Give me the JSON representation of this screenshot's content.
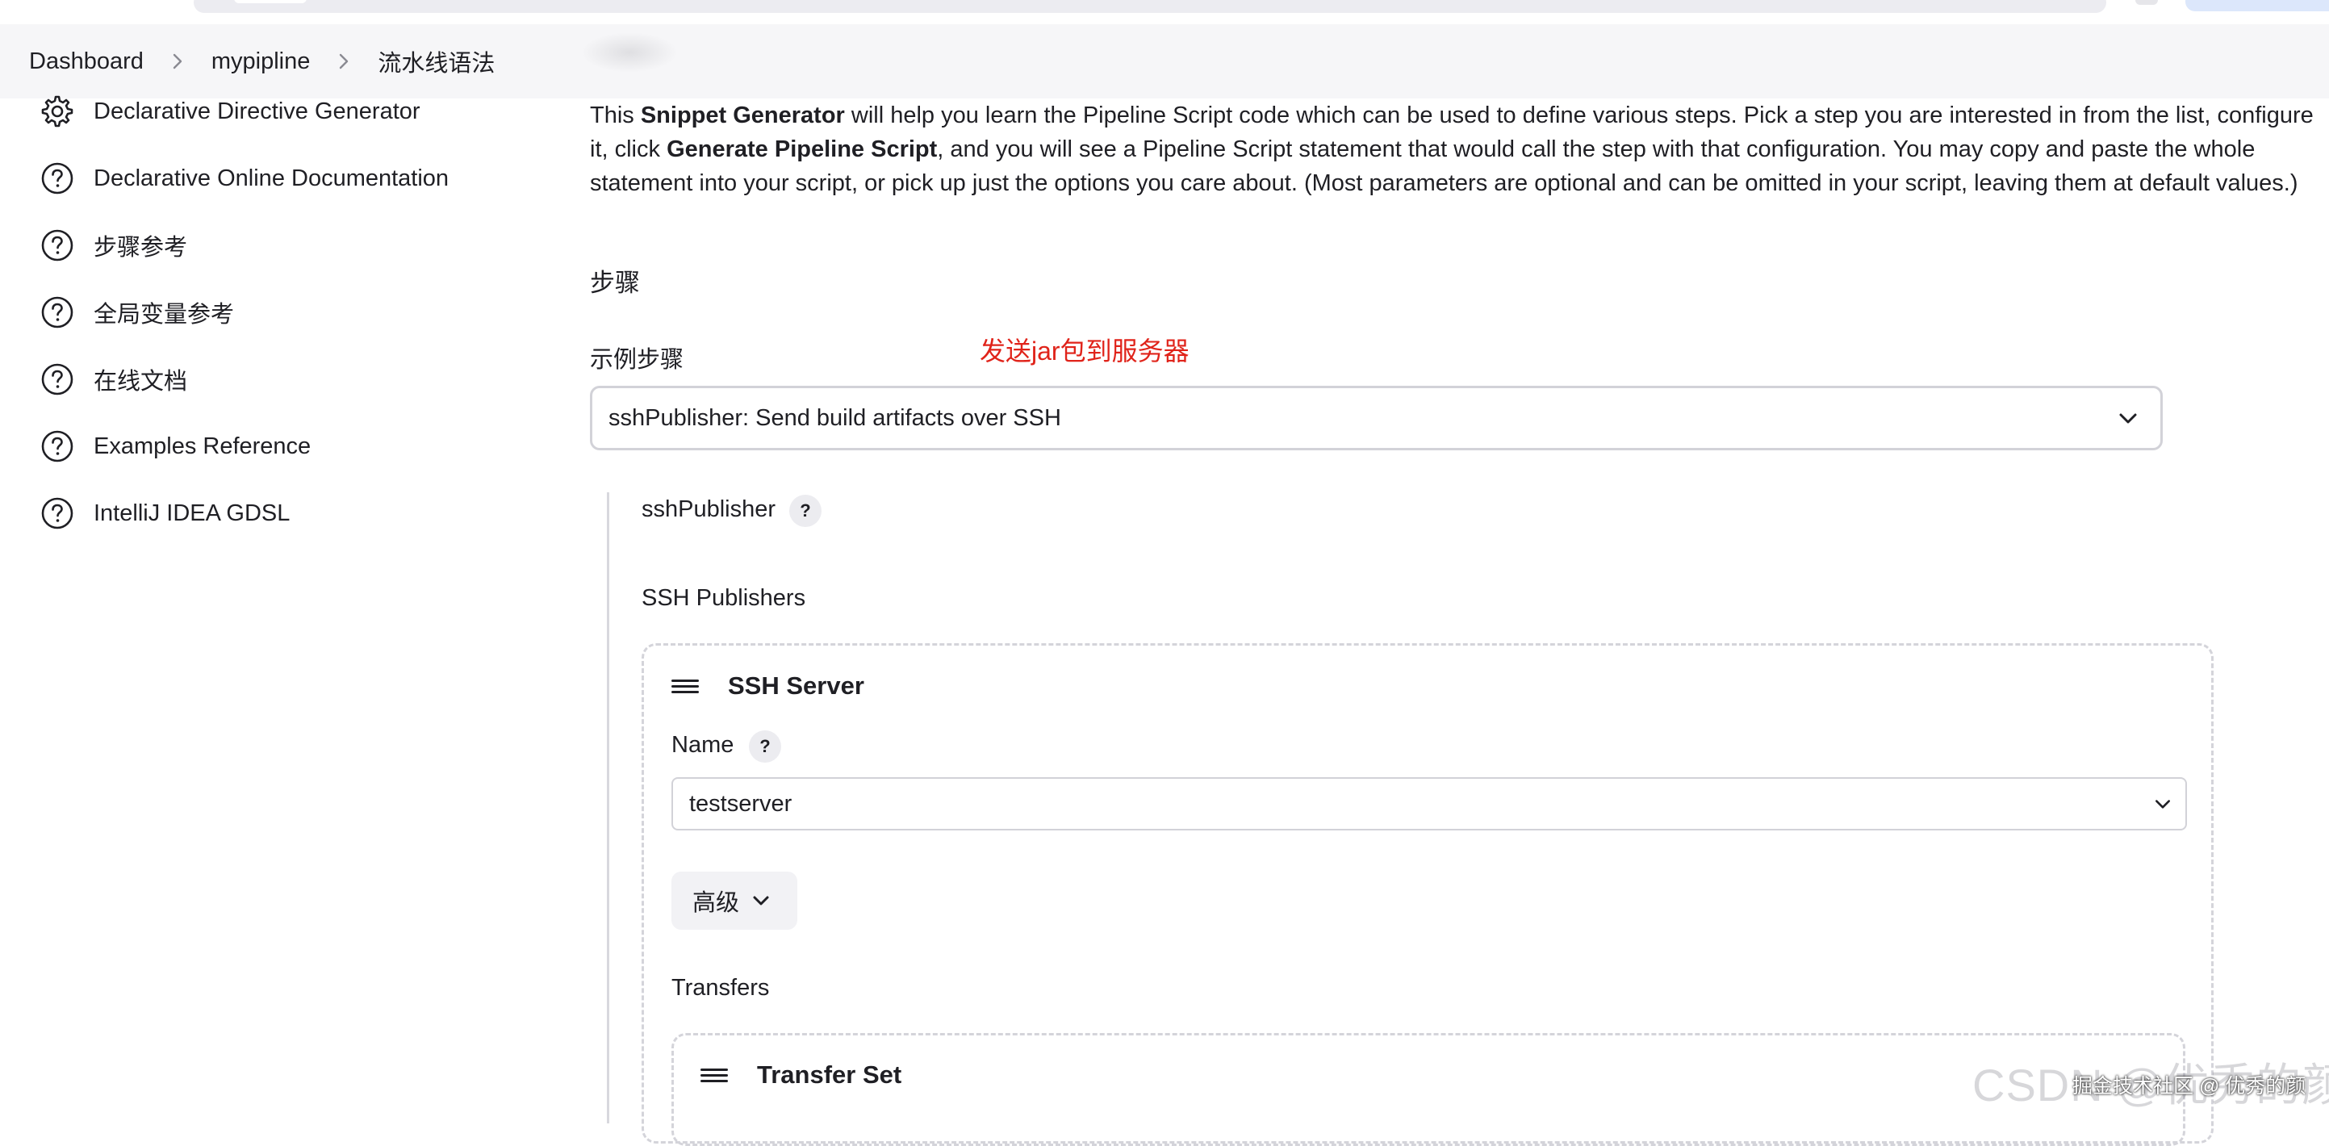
{
  "breadcrumb": {
    "items": [
      "Dashboard",
      "mypipline",
      "流水线语法"
    ]
  },
  "sidebar": {
    "items": [
      {
        "label": "Declarative Directive Generator",
        "icon": "gear-icon"
      },
      {
        "label": "Declarative Online Documentation",
        "icon": "help-circle-icon"
      },
      {
        "label": "步骤参考",
        "icon": "help-circle-icon"
      },
      {
        "label": "全局变量参考",
        "icon": "help-circle-icon"
      },
      {
        "label": "在线文档",
        "icon": "help-circle-icon"
      },
      {
        "label": "Examples Reference",
        "icon": "help-circle-icon"
      },
      {
        "label": "IntelliJ IDEA GDSL",
        "icon": "help-circle-icon"
      }
    ]
  },
  "intro": {
    "t1": "This ",
    "b1": "Snippet Generator",
    "t2": " will help you learn the Pipeline Script code which can be used to define various steps. Pick a step you are interested in from the list, configure it, click ",
    "b2": "Generate Pipeline Script",
    "t3": ", and you will see a Pipeline Script statement that would call the step with that configuration. You may copy and paste the whole statement into your script, or pick up just the options you care about. (Most parameters are optional and can be omitted in your script, leaving them at default values.)"
  },
  "steps": {
    "heading": "步骤",
    "sample_label": "示例步骤",
    "annotation": "发送jar包到服务器",
    "selected_step": "sshPublisher: Send build artifacts over SSH"
  },
  "ssh_publisher": {
    "label": "sshPublisher",
    "help": "?",
    "publishers_label": "SSH Publishers",
    "server": {
      "title": "SSH Server",
      "name_label": "Name",
      "name_help": "?",
      "name_value": "testserver",
      "advanced_label": "高级",
      "transfers_label": "Transfers",
      "transfer_set_title": "Transfer Set"
    }
  },
  "watermark": {
    "text": "CSDN @优秀的颜",
    "overlay": "掘金技术社区 @ 优秀的颜"
  },
  "colors": {
    "annotation_red": "#e0231a",
    "breadcrumb_bg": "#f6f6f8",
    "border": "#d2d2d8"
  }
}
